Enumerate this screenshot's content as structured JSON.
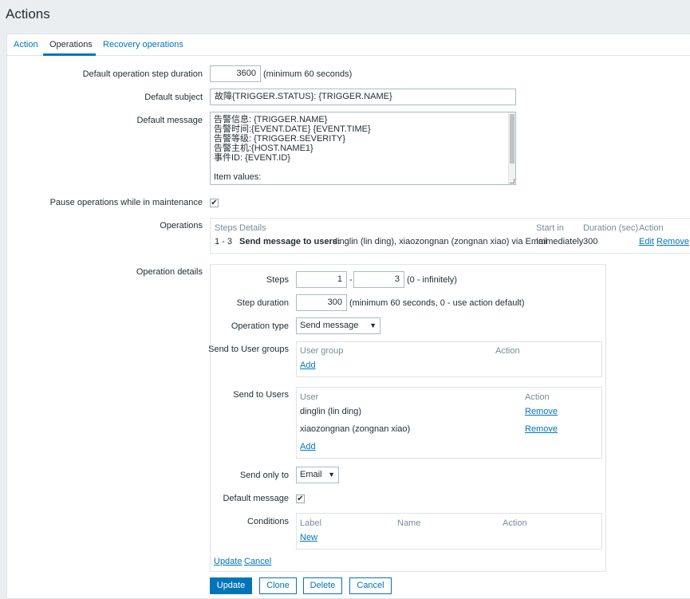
{
  "page": {
    "title": "Actions"
  },
  "tabs": [
    {
      "label": "Action"
    },
    {
      "label": "Operations"
    },
    {
      "label": "Recovery operations"
    }
  ],
  "form": {
    "step_duration": {
      "label": "Default operation step duration",
      "value": "3600",
      "hint": "(minimum 60 seconds)"
    },
    "subject": {
      "label": "Default subject",
      "value": "故障{TRIGGER.STATUS}: {TRIGGER.NAME}"
    },
    "message": {
      "label": "Default message",
      "lines": [
        "告警信息: {TRIGGER.NAME}",
        "告警时间:{EVENT.DATE} {EVENT.TIME}",
        "告警等级: {TRIGGER.SEVERITY}",
        "告警主机:{HOST.NAME1}",
        "事件ID: {EVENT.ID}",
        "",
        "Item values:"
      ]
    },
    "pause": {
      "label": "Pause operations while in maintenance",
      "checked": true
    },
    "operations": {
      "label": "Operations",
      "headers": {
        "steps": "Steps",
        "details": "Details",
        "start_in": "Start in",
        "duration": "Duration (sec)",
        "action": "Action"
      },
      "row": {
        "steps": "1 - 3",
        "details_bold": "Send message to users:",
        "details_rest": "dinglin (lin ding), xiaozongnan (zongnan xiao) via Email",
        "start_in": "Immediately",
        "duration": "300",
        "edit": "Edit",
        "remove": "Remove"
      }
    }
  },
  "details": {
    "label": "Operation details",
    "steps": {
      "label": "Steps",
      "from": "1",
      "sep": "-",
      "to": "3",
      "hint": "(0 - infinitely)"
    },
    "step_duration": {
      "label": "Step duration",
      "value": "300",
      "hint": "(minimum 60 seconds, 0 - use action default)"
    },
    "operation_type": {
      "label": "Operation type",
      "value": "Send message"
    },
    "user_groups": {
      "label": "Send to User groups",
      "col1": "User group",
      "col2": "Action",
      "add": "Add"
    },
    "users": {
      "label": "Send to Users",
      "col1": "User",
      "col2": "Action",
      "rows": [
        {
          "name": "dinglin (lin ding)",
          "action": "Remove"
        },
        {
          "name": "xiaozongnan (zongnan xiao)",
          "action": "Remove"
        }
      ],
      "add": "Add"
    },
    "send_only_to": {
      "label": "Send only to",
      "value": "Email"
    },
    "default_message": {
      "label": "Default message",
      "checked": true
    },
    "conditions": {
      "label": "Conditions",
      "col1": "Label",
      "col2": "Name",
      "col3": "Action",
      "new": "New"
    },
    "update_link": "Update",
    "cancel_link": "Cancel"
  },
  "buttons": {
    "update": "Update",
    "clone": "Clone",
    "delete": "Delete",
    "cancel": "Cancel"
  },
  "colors": {
    "accent": "#0275b8",
    "background": "#ebeef0",
    "text": "#1f2c33",
    "muted": "#768d99"
  },
  "icons": {
    "checkbox_check": "check-icon",
    "select_caret": "caret-down-icon"
  }
}
